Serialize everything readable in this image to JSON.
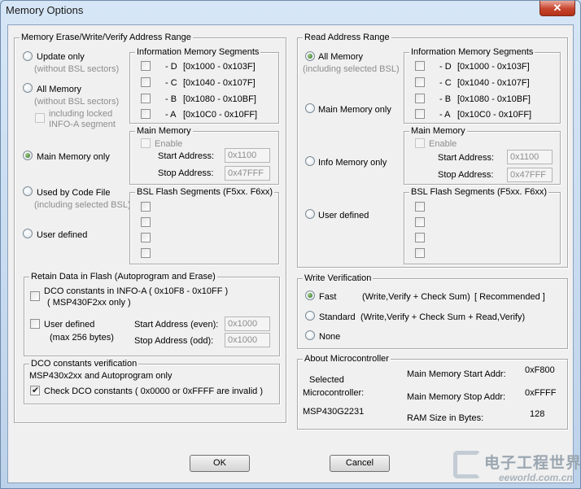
{
  "window": {
    "title": "Memory Options",
    "close": "✕"
  },
  "erase": {
    "title": "Memory Erase/Write/Verify Address Range",
    "opts": {
      "update": {
        "label": "Update only",
        "sub": "(without BSL sectors)"
      },
      "all": {
        "label": "All Memory",
        "sub": "(without BSL sectors)"
      },
      "locked": {
        "l1": "including locked",
        "l2": "INFO-A segment"
      },
      "main": {
        "label": "Main Memory only"
      },
      "code": {
        "label": "Used by Code File",
        "sub": "(including selected BSL)"
      },
      "user": {
        "label": "User defined"
      }
    },
    "info": {
      "title": "Information Memory Segments",
      "segs": [
        {
          "l": "- D",
          "r": "[0x1000 - 0x103F]"
        },
        {
          "l": "- C",
          "r": "[0x1040 - 0x107F]"
        },
        {
          "l": "- B",
          "r": "[0x1080 - 0x10BF]"
        },
        {
          "l": "- A",
          "r": "[0x10C0 - 0x10FF]"
        }
      ]
    },
    "mainmem": {
      "title": "Main Memory",
      "enable": "Enable",
      "start_label": "Start Address:",
      "start_value": "0x1100",
      "stop_label": "Stop Address:",
      "stop_value": "0x47FFF"
    },
    "bsl": {
      "title": "BSL Flash Segments (F5xx. F6xx)"
    }
  },
  "read": {
    "title": "Read Address Range",
    "all": {
      "label": "All Memory",
      "sub": "(including selected BSL)"
    },
    "main": "Main Memory only",
    "info_only": "Info Memory only",
    "user": "User defined",
    "info": {
      "title": "Information Memory Segments",
      "segs": [
        {
          "l": "- D",
          "r": "[0x1000 - 0x103F]"
        },
        {
          "l": "- C",
          "r": "[0x1040 - 0x107F]"
        },
        {
          "l": "- B",
          "r": "[0x1080 - 0x10BF]"
        },
        {
          "l": "- A",
          "r": "[0x10C0 - 0x10FF]"
        }
      ]
    },
    "mainmem": {
      "title": "Main Memory",
      "enable": "Enable",
      "start_label": "Start Address:",
      "start_value": "0x1100",
      "stop_label": "Stop Address:",
      "stop_value": "0x47FFF"
    },
    "bsl": {
      "title": "BSL Flash Segments (F5xx. F6xx)"
    }
  },
  "retain": {
    "title": "Retain Data in Flash   (Autoprogram and Erase)",
    "dco_l1": "DCO constants in INFO-A ( 0x10F8 - 0x10FF )",
    "dco_l2": "( MSP430F2xx only )",
    "user_label": "User defined",
    "user_sub": "(max 256 bytes)",
    "start_label": "Start Address (even):",
    "start_value": "0x1000",
    "stop_label": "Stop Address (odd):",
    "stop_value": "0x1000"
  },
  "dco": {
    "title": "DCO constants verification",
    "note": "MSP430x2xx and Autoprogram only",
    "check": "Check DCO constants ( 0x0000 or 0xFFFF are invalid )"
  },
  "write": {
    "title": "Write Verification",
    "fast": "Fast",
    "fast_desc": "(Write,Verify + Check Sum)",
    "fast_rec": "[ Recommended ]",
    "standard": "Standard",
    "standard_desc": "(Write,Verify + Check Sum + Read,Verify)",
    "none": "None"
  },
  "about": {
    "title": "About Microcontroller",
    "selected_l1": "Selected",
    "selected_l2": "Microcontroller:",
    "device": "MSP430G2231",
    "start_label": "Main Memory Start Addr:",
    "start_value": "0xF800",
    "stop_label": "Main Memory Stop Addr:",
    "stop_value": "0xFFFF",
    "ram_label": "RAM Size in Bytes:",
    "ram_value": "128"
  },
  "buttons": {
    "ok": "OK",
    "cancel": "Cancel"
  },
  "watermark": {
    "cn": "电子工程世界",
    "en": "eeworld.com.cn"
  }
}
